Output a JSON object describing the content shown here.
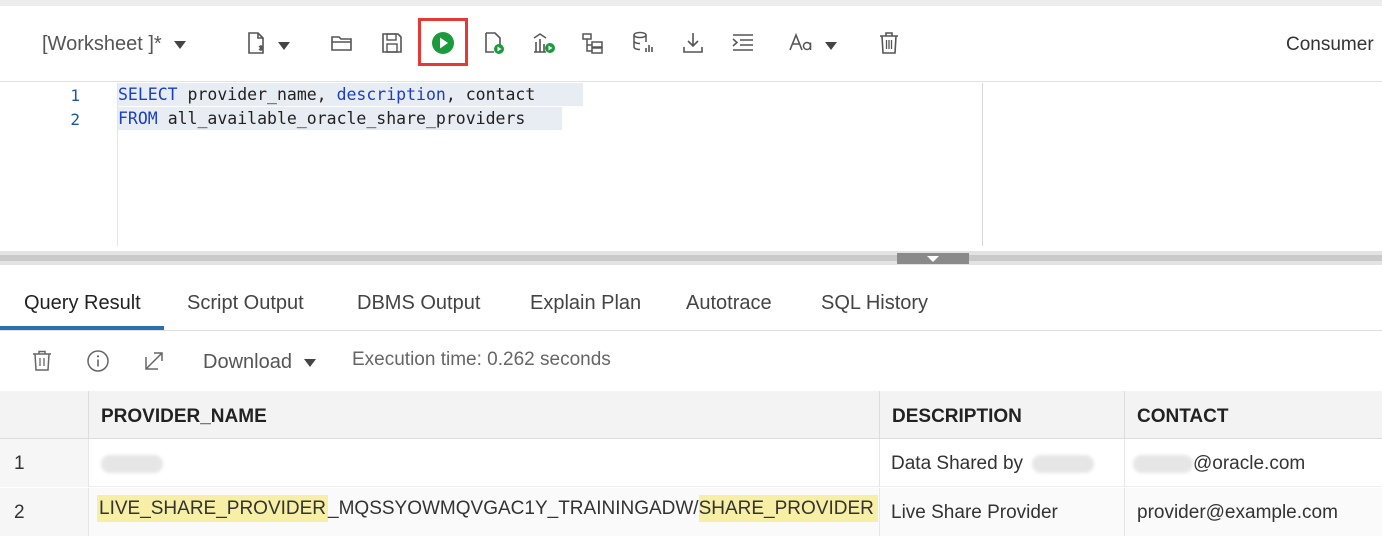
{
  "toolbar": {
    "worksheet_label": "[Worksheet ]*",
    "consumer_label": "Consumer",
    "icons": [
      "new-file-icon",
      "open-folder-icon",
      "save-icon",
      "run-statement-icon",
      "run-script-icon",
      "explain-plan-icon",
      "autotrace-icon",
      "sql-data-icon",
      "download-icon",
      "format-icon",
      "font-size-icon",
      "clear-icon"
    ],
    "run_highlight_color": "#e53935",
    "run_color": "#1a9b3c"
  },
  "editor": {
    "lines": [
      {
        "number": "1",
        "keyword": "SELECT",
        "rest_1": "provider_name,",
        "keyword_2": "description",
        "rest_2": ", contact"
      },
      {
        "number": "2",
        "keyword": "FROM",
        "rest_1": "all_available_oracle_share_providers"
      }
    ]
  },
  "result_tabs": [
    "Query Result",
    "Script Output",
    "DBMS Output",
    "Explain Plan",
    "Autotrace",
    "SQL History"
  ],
  "active_tab": "Query Result",
  "result_toolbar": {
    "download_label": "Download",
    "execution_time": "Execution time: 0.262 seconds"
  },
  "grid": {
    "columns": [
      "PROVIDER_NAME",
      "DESCRIPTION",
      "CONTACT"
    ],
    "rows": [
      {
        "num": "1",
        "provider_name": "",
        "description": "Data Shared by",
        "contact": "@oracle.com"
      },
      {
        "num": "2",
        "provider_name_parts": [
          "LIVE_SHARE_PROVIDER",
          "_MQSSYOWMQVGAC1Y_TRAININGADW/",
          "SHARE_PROVIDER"
        ],
        "description": "Live Share Provider",
        "contact": "provider@example.com"
      }
    ],
    "highlight_color": "#f7efa6"
  }
}
